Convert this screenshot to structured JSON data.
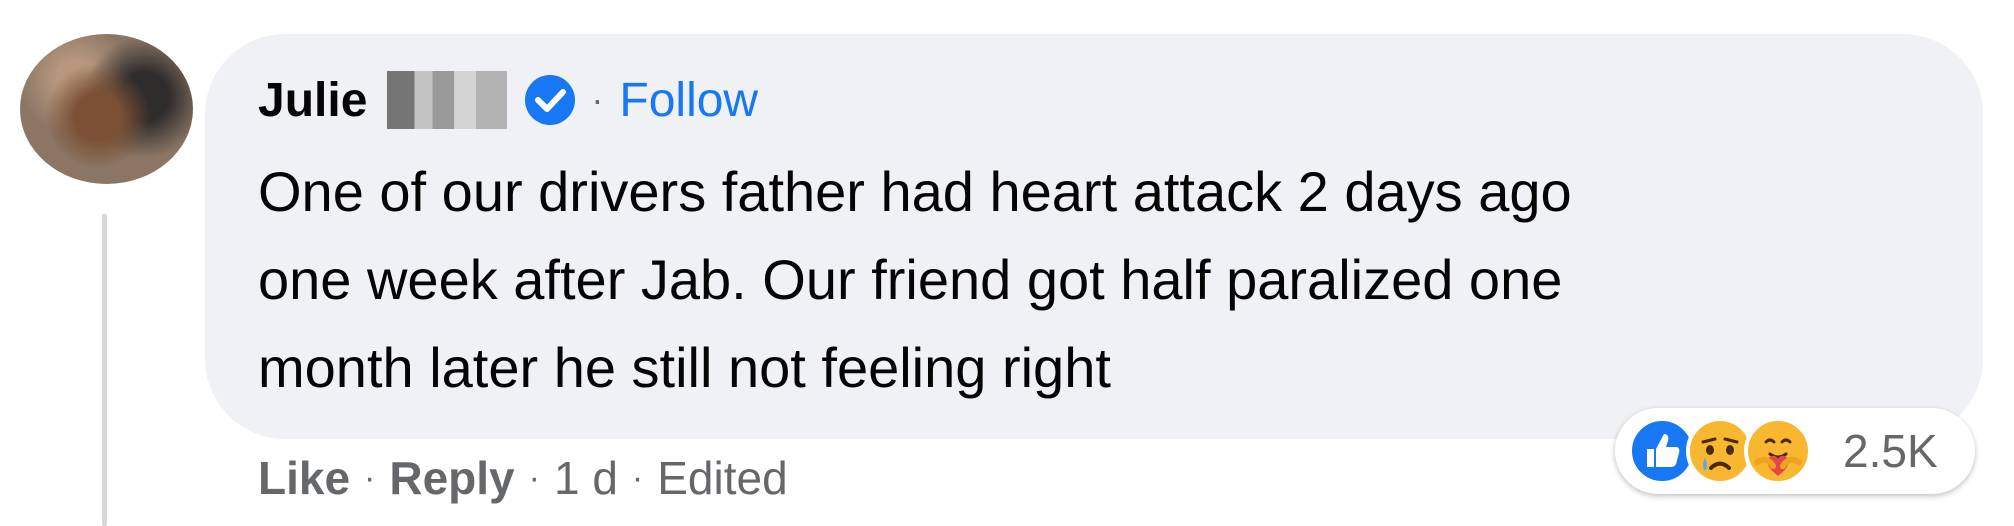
{
  "comment": {
    "author": "Julie",
    "follow_label": "Follow",
    "separator": "·",
    "text": "One of our drivers father had heart attack 2 days ago\none week after Jab. Our friend got half paralized one\nmonth later he still not feeling right"
  },
  "actions": {
    "like_label": "Like",
    "reply_label": "Reply",
    "time": "1 d",
    "edited_label": "Edited"
  },
  "reactions": {
    "count": "2.5K",
    "types": [
      "like",
      "sad",
      "care"
    ]
  },
  "colors": {
    "bubble": "#f0f1f4",
    "follow": "#1877f2",
    "verified": "#1877f2",
    "meta_text": "#65676b"
  }
}
